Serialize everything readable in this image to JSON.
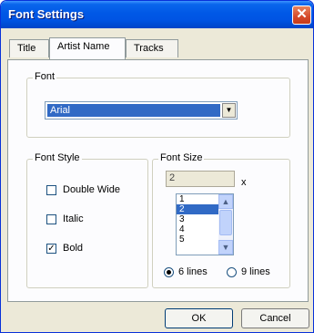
{
  "window": {
    "title": "Font Settings",
    "close_glyph": "✕"
  },
  "tabs": [
    {
      "label": "Title",
      "active": false
    },
    {
      "label": "Artist Name",
      "active": true
    },
    {
      "label": "Tracks",
      "active": false
    }
  ],
  "font": {
    "label": "Font",
    "selected": "Arial",
    "arrow_glyph": "▼"
  },
  "font_style": {
    "label": "Font Style",
    "options": [
      {
        "label": "Double Wide",
        "checked": false,
        "mark": ""
      },
      {
        "label": "Italic",
        "checked": false,
        "mark": ""
      },
      {
        "label": "Bold",
        "checked": true,
        "mark": "✓"
      }
    ]
  },
  "font_size": {
    "label": "Font Size",
    "value": "2",
    "multiplier": "x",
    "list": [
      "1",
      "2",
      "3",
      "4",
      "5"
    ],
    "selected_index": 1,
    "scroll_up_glyph": "▲",
    "scroll_down_glyph": "▼",
    "lines": [
      {
        "label": "6 lines",
        "selected": true
      },
      {
        "label": "9 lines",
        "selected": false
      }
    ]
  },
  "buttons": {
    "ok": "OK",
    "cancel": "Cancel"
  }
}
